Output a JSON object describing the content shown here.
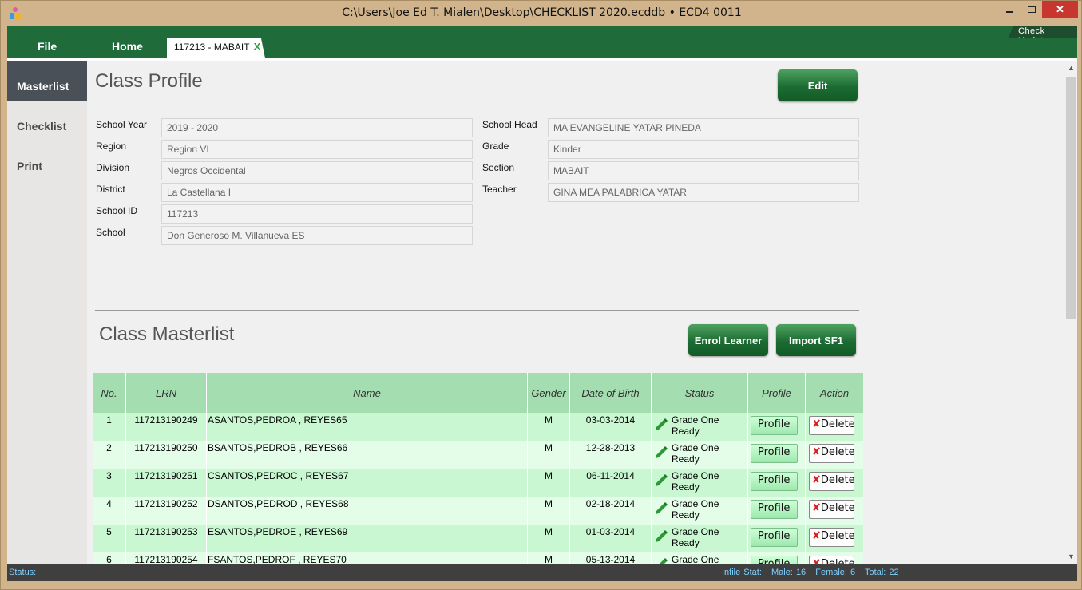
{
  "window": {
    "title": "C:\\Users\\Joe Ed T. Mialen\\Desktop\\CHECKLIST 2020.ecddb   •   ECD4 0011"
  },
  "ribbon": {
    "file_label": "File",
    "home_label": "Home",
    "doc_tab_label": "117213 -   MABAIT",
    "doc_tab_close": "X",
    "check_update_label": "Check Update"
  },
  "sidebar": {
    "items": [
      {
        "label": "Masterlist",
        "active": true
      },
      {
        "label": "Checklist",
        "active": false
      },
      {
        "label": "Print",
        "active": false
      }
    ]
  },
  "profile": {
    "title": "Class Profile",
    "edit_label": "Edit",
    "fields_left": [
      {
        "label": "School Year",
        "value": "2019 - 2020"
      },
      {
        "label": "Region",
        "value": "Region VI"
      },
      {
        "label": "Division",
        "value": "Negros Occidental"
      },
      {
        "label": "District",
        "value": "La Castellana I"
      },
      {
        "label": "School ID",
        "value": "117213"
      },
      {
        "label": "School",
        "value": "Don Generoso M. Villanueva ES"
      }
    ],
    "fields_right": [
      {
        "label": "School Head",
        "value": "MA EVANGELINE YATAR PINEDA"
      },
      {
        "label": "Grade",
        "value": "Kinder"
      },
      {
        "label": "Section",
        "value": "MABAIT"
      },
      {
        "label": "Teacher",
        "value": "GINA MEA PALABRICA YATAR"
      }
    ]
  },
  "masterlist": {
    "title": "Class Masterlist",
    "enrol_label": "Enrol Learner",
    "import_label": "Import SF1",
    "columns": [
      "No.",
      "LRN",
      "Name",
      "Gender",
      "Date of Birth",
      "Status",
      "Profile",
      "Action"
    ],
    "profile_btn_label": "Profile",
    "delete_btn_label": "Delete",
    "rows": [
      {
        "no": "1",
        "lrn": "117213190249",
        "name": "ASANTOS,PEDROA , REYES65",
        "gender": "M",
        "dob": "03-03-2014",
        "status": "Grade One Ready"
      },
      {
        "no": "2",
        "lrn": "117213190250",
        "name": "BSANTOS,PEDROB , REYES66",
        "gender": "M",
        "dob": "12-28-2013",
        "status": "Grade One Ready"
      },
      {
        "no": "3",
        "lrn": "117213190251",
        "name": "CSANTOS,PEDROC , REYES67",
        "gender": "M",
        "dob": "06-11-2014",
        "status": "Grade One Ready"
      },
      {
        "no": "4",
        "lrn": "117213190252",
        "name": "DSANTOS,PEDROD , REYES68",
        "gender": "M",
        "dob": "02-18-2014",
        "status": "Grade One Ready"
      },
      {
        "no": "5",
        "lrn": "117213190253",
        "name": "ESANTOS,PEDROE , REYES69",
        "gender": "M",
        "dob": "01-03-2014",
        "status": "Grade One Ready"
      },
      {
        "no": "6",
        "lrn": "117213190254",
        "name": "FSANTOS,PEDROF , REYES70",
        "gender": "M",
        "dob": "05-13-2014",
        "status": "Grade One Ready"
      }
    ]
  },
  "statusbar": {
    "status_label": "Status:",
    "infile_stat": "Infile Stat:",
    "male": "Male: 16",
    "female": "Female: 6",
    "total": "Total: 22"
  },
  "colors": {
    "ribbon": "#1f6b3a",
    "button_green": "#1c6b33",
    "table_header": "#a4ddb0",
    "row_even": "#c9f7d2",
    "row_odd": "#e3fde8"
  }
}
